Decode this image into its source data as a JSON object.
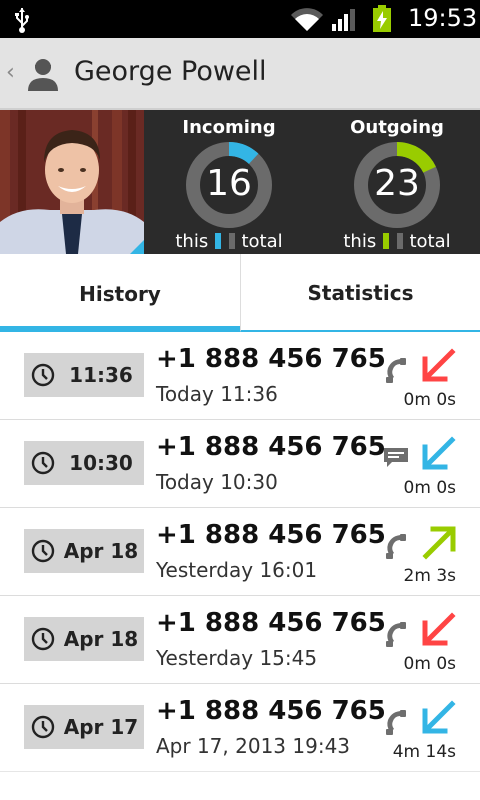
{
  "status_bar": {
    "time": "19:53",
    "icons": [
      "usb-icon",
      "wifi-icon",
      "signal-icon",
      "battery-charging-icon"
    ]
  },
  "action_bar": {
    "title": "George Powell",
    "icons": [
      "up-caret-icon",
      "contact-avatar-icon"
    ]
  },
  "stats": {
    "incoming": {
      "label": "Incoming",
      "value": "16",
      "fraction_this": 0.12,
      "color": "#33b5e5"
    },
    "outgoing": {
      "label": "Outgoing",
      "value": "23",
      "fraction_this": 0.18,
      "color": "#99cc00"
    },
    "legend_this": "this",
    "legend_total": "total",
    "ring_total_color": "#6b6b6b"
  },
  "tabs": [
    {
      "label": "History",
      "selected": true
    },
    {
      "label": "Statistics",
      "selected": false
    }
  ],
  "calls": [
    {
      "pill": "11:36",
      "number": "+1 888 456 765",
      "sub": "Today 11:36",
      "type": "call",
      "direction": "incoming-missed",
      "duration": "0m 0s"
    },
    {
      "pill": "10:30",
      "number": "+1 888 456 765",
      "sub": "Today 10:30",
      "type": "sms",
      "direction": "incoming",
      "duration": "0m 0s"
    },
    {
      "pill": "Apr 18",
      "number": "+1 888 456 765",
      "sub": "Yesterday 16:01",
      "type": "call",
      "direction": "outgoing",
      "duration": "2m 3s"
    },
    {
      "pill": "Apr 18",
      "number": "+1 888 456 765",
      "sub": "Yesterday 15:45",
      "type": "call",
      "direction": "incoming-missed",
      "duration": "0m 0s"
    },
    {
      "pill": "Apr 17",
      "number": "+1 888 456 765",
      "sub": "Apr 17, 2013 19:43",
      "type": "call",
      "direction": "incoming",
      "duration": "4m 14s"
    }
  ],
  "colors": {
    "accent": "#33b5e5",
    "missed": "#ff4444",
    "outgoing": "#99cc00"
  }
}
